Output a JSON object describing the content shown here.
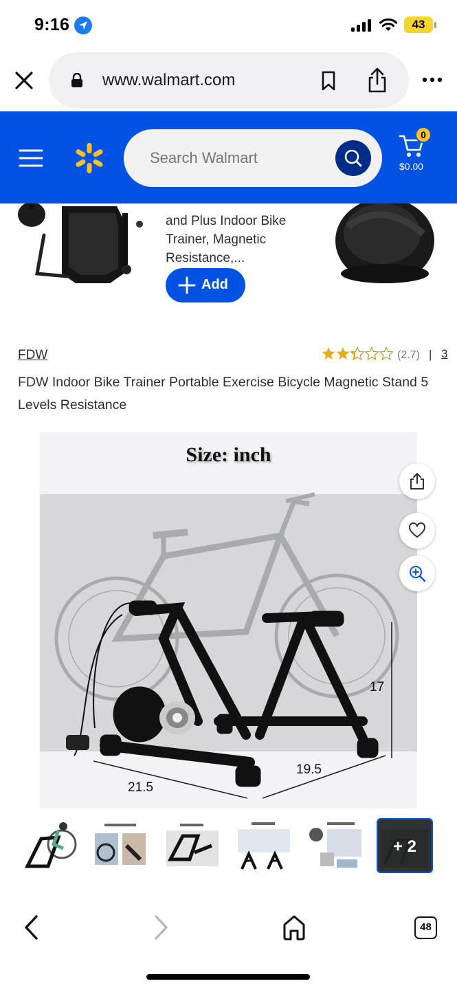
{
  "status_bar": {
    "time": "9:16",
    "battery": "43"
  },
  "browser": {
    "url": "www.walmart.com",
    "tab_count": "48"
  },
  "header": {
    "search_placeholder": "Search Walmart",
    "cart_count": "0",
    "cart_total": "$0.00",
    "brand_color": "#0053e2",
    "accent_color": "#ffc220"
  },
  "recommendation": {
    "title_fragment": "and Plus Indoor Bike Trainer, Magnetic Resistance,...",
    "add_label": "Add"
  },
  "product": {
    "brand": "FDW",
    "rating": 2.7,
    "rating_text": "(2.7)",
    "separator": "|",
    "review_count": "3",
    "title": "FDW Indoor Bike Trainer Portable Exercise Bicycle Magnetic Stand 5 Levels Resistance"
  },
  "main_image": {
    "caption": "Size: inch",
    "dimensions": {
      "width": "21.5",
      "depth": "19.5",
      "height": "17"
    },
    "icons": [
      "share-icon",
      "heart-icon",
      "zoom-icon"
    ]
  },
  "thumbnails": {
    "count_visible": 6,
    "selected_index": 5,
    "more_label": "+ 2"
  },
  "toolbar": {
    "icons": [
      "back-icon",
      "forward-icon",
      "home-icon",
      "tabs-icon"
    ]
  }
}
